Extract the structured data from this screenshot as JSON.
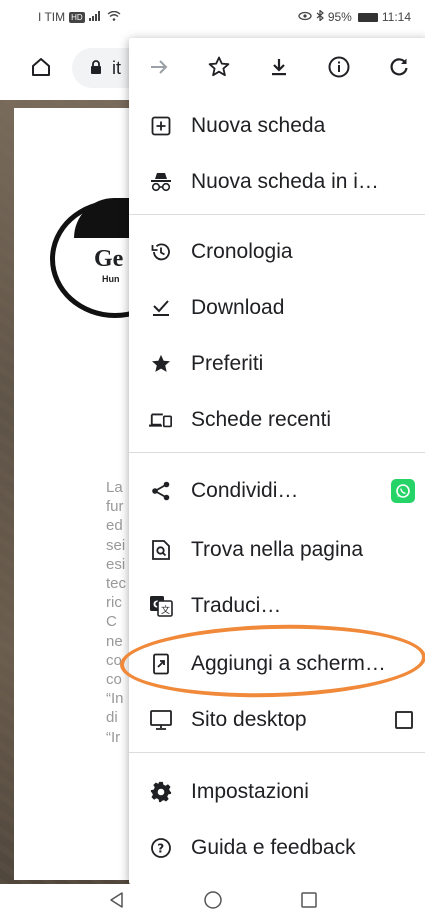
{
  "status_bar": {
    "carrier": "I TIM",
    "hd": "HD",
    "battery_percent": "95%",
    "time": "11:14"
  },
  "toolbar": {
    "url_partial": "it"
  },
  "page": {
    "logo_word": "Ge",
    "logo_subtitle": "Hun",
    "text_lines": [
      "La",
      "fur",
      "ed",
      "sei",
      "esi",
      "tec",
      "ric",
      "C",
      "ne",
      "co",
      "co",
      "“In",
      "di",
      "“Ir"
    ]
  },
  "menu": {
    "icon_row": [
      "forward-icon",
      "star-icon",
      "download-icon",
      "info-icon",
      "refresh-icon"
    ],
    "items": [
      {
        "label": "Nuova scheda",
        "icon": "new-tab-icon"
      },
      {
        "label": "Nuova scheda in i…",
        "icon": "incognito-icon"
      },
      {
        "label": "Cronologia",
        "icon": "history-icon"
      },
      {
        "label": "Download",
        "icon": "downloads-icon"
      },
      {
        "label": "Preferiti",
        "icon": "bookmarks-star-icon"
      },
      {
        "label": "Schede recenti",
        "icon": "recent-tabs-icon"
      },
      {
        "label": "Condividi…",
        "icon": "share-icon"
      },
      {
        "label": "Trova nella pagina",
        "icon": "find-in-page-icon"
      },
      {
        "label": "Traduci…",
        "icon": "translate-icon"
      },
      {
        "label": "Aggiungi a scherm…",
        "icon": "add-to-home-icon"
      },
      {
        "label": "Sito desktop",
        "icon": "desktop-site-icon"
      },
      {
        "label": "Impostazioni",
        "icon": "settings-icon"
      },
      {
        "label": "Guida e feedback",
        "icon": "help-icon"
      }
    ],
    "desktop_site_checked": false
  },
  "colors": {
    "highlight_ring": "#f08a3a",
    "whatsapp": "#25d366"
  }
}
